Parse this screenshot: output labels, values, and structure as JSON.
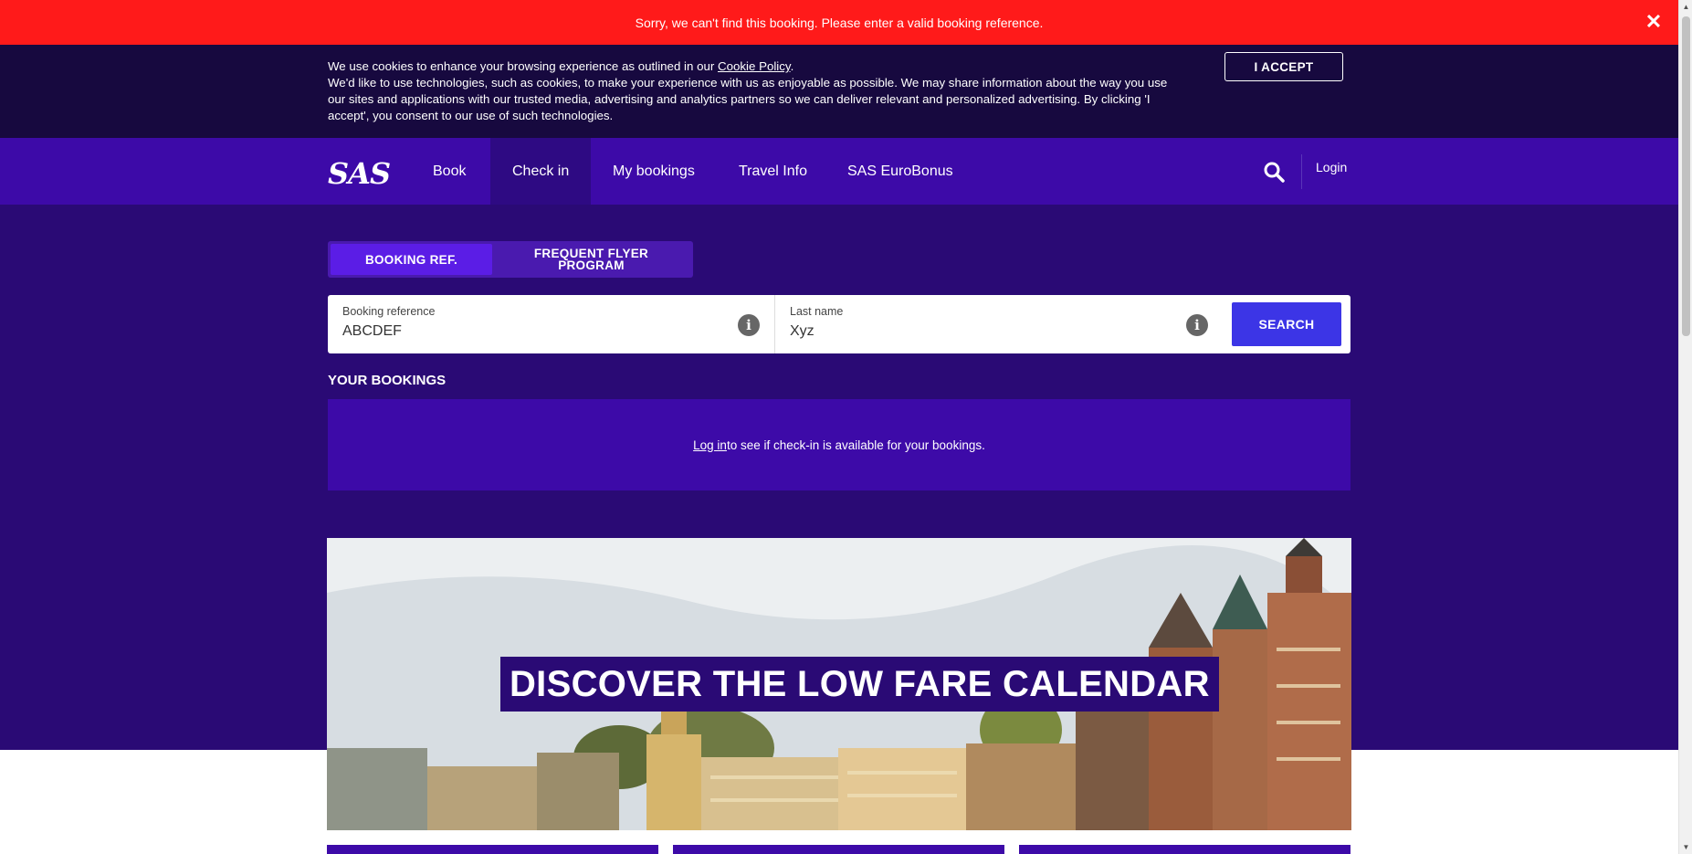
{
  "error_banner": {
    "message": "Sorry, we can't find this booking. Please enter a valid booking reference.",
    "close_icon": "close-icon"
  },
  "cookie": {
    "text_1": "We use cookies to enhance your browsing experience as outlined in our ",
    "policy_link": "Cookie Policy",
    "text_2": ".",
    "text_3": "We'd like to use technologies, such as cookies, to make your experience with us as enjoyable as possible. We may share information about the way you use our sites and applications with our trusted media, advertising and analytics partners so we can deliver relevant and personalized advertising. By clicking 'I accept', you consent to our use of such technologies.",
    "accept_label": "I ACCEPT"
  },
  "nav": {
    "logo": "SAS",
    "items": [
      {
        "label": "Book"
      },
      {
        "label": "Check in"
      },
      {
        "label": "My bookings"
      },
      {
        "label": "Travel Info"
      },
      {
        "label": "SAS EuroBonus"
      }
    ],
    "login": "Login"
  },
  "checkin": {
    "tabs": [
      {
        "label": "BOOKING REF."
      },
      {
        "label": "FREQUENT FLYER PROGRAM"
      }
    ],
    "booking_ref_label": "Booking reference",
    "booking_ref_value": "ABCDEF",
    "last_name_label": "Last name",
    "last_name_value": "Xyz",
    "search_label": "SEARCH"
  },
  "your_bookings": {
    "heading": "YOUR BOOKINGS",
    "login_link": "Log in ",
    "message": "to see if check-in is available for your bookings."
  },
  "promo": {
    "title": "DISCOVER THE LOW FARE CALENDAR"
  },
  "colors": {
    "error": "#ff1a1a",
    "cookie_bg": "#17093f",
    "nav_bg": "#3d0aa8",
    "hero_bg": "#2a0a75",
    "search_button": "#3c35e6"
  }
}
